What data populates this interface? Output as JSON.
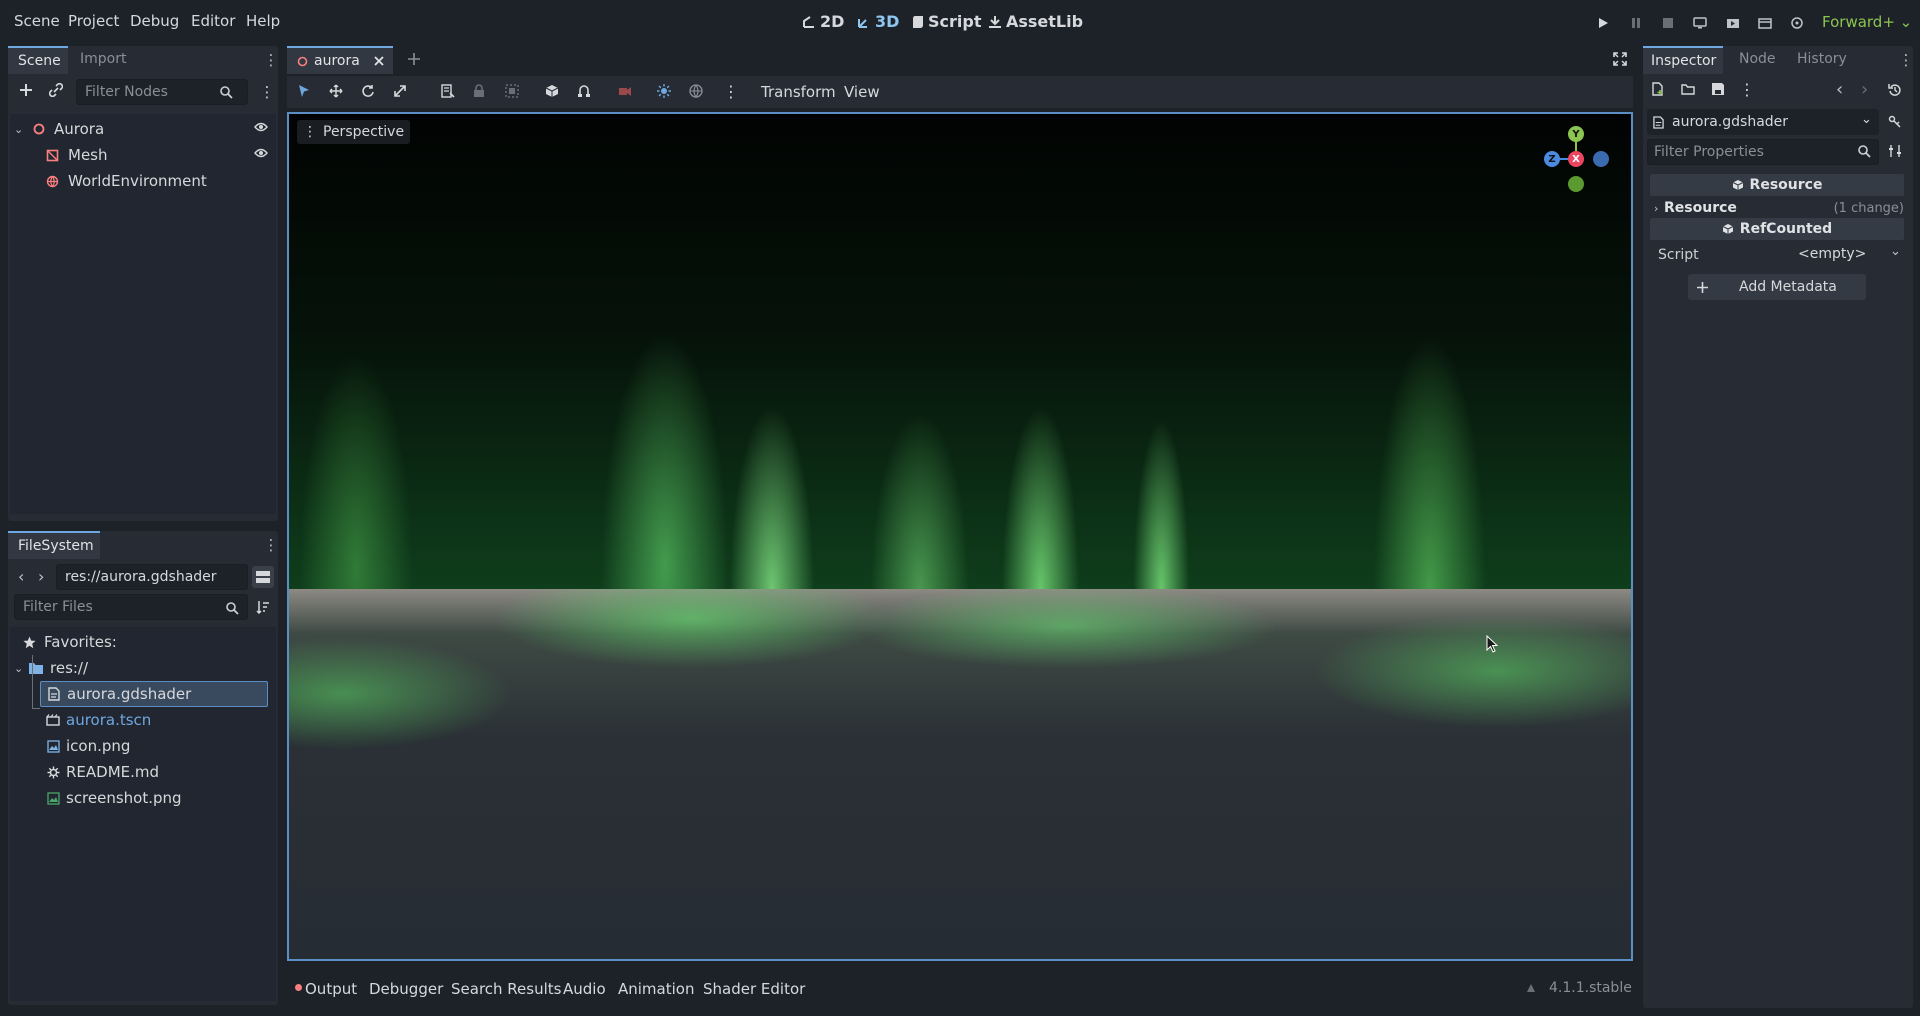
{
  "menubar": {
    "items": [
      "Scene",
      "Project",
      "Debug",
      "Editor",
      "Help"
    ],
    "workspaces": [
      "2D",
      "3D",
      "Script",
      "AssetLib"
    ],
    "active_workspace": "3D",
    "renderer": "Forward+"
  },
  "scene_dock": {
    "tabs": [
      "Scene",
      "Import"
    ],
    "filter_placeholder": "Filter Nodes",
    "nodes": [
      {
        "label": "Aurora",
        "icon": "node3d-icon"
      },
      {
        "label": "Mesh",
        "icon": "mesh-icon"
      },
      {
        "label": "WorldEnvironment",
        "icon": "world-environment-icon"
      }
    ]
  },
  "filesystem_dock": {
    "tab": "FileSystem",
    "path": "res://aurora.gdshader",
    "filter_placeholder": "Filter Files",
    "favorites_label": "Favorites:",
    "root_label": "res://",
    "files": [
      {
        "label": "aurora.gdshader",
        "icon": "shader-file-icon",
        "selected": true
      },
      {
        "label": "aurora.tscn",
        "icon": "scene-file-icon",
        "highlight": true
      },
      {
        "label": "icon.png",
        "icon": "image-file-icon"
      },
      {
        "label": "README.md",
        "icon": "text-file-icon"
      },
      {
        "label": "screenshot.png",
        "icon": "image-file-icon"
      }
    ]
  },
  "editor_tabs": {
    "scene_tab": "aurora"
  },
  "viewport_toolbar": {
    "transform_label": "Transform",
    "view_label": "View",
    "perspective_label": "Perspective"
  },
  "gizmo": {
    "y": "Y",
    "x": "X",
    "z": "Z"
  },
  "inspector": {
    "tabs": [
      "Inspector",
      "Node",
      "History"
    ],
    "resource_name": "aurora.gdshader",
    "filter_placeholder": "Filter Properties",
    "section_resource": "Resource",
    "resource_group": "Resource",
    "resource_changes": "(1 change)",
    "section_refcounted": "RefCounted",
    "script_label": "Script",
    "script_value": "<empty>",
    "add_metadata": "Add Metadata"
  },
  "bottom_panel": {
    "tabs": [
      "Output",
      "Debugger",
      "Search Results",
      "Audio",
      "Animation",
      "Shader Editor"
    ],
    "version": "4.1.1.stable"
  },
  "colors": {
    "accent": "#6fa7e0",
    "panel_bg": "#272c34",
    "app_bg": "#1d2229",
    "renderer_green": "#8cc450",
    "node_red": "#fc7f7f"
  }
}
